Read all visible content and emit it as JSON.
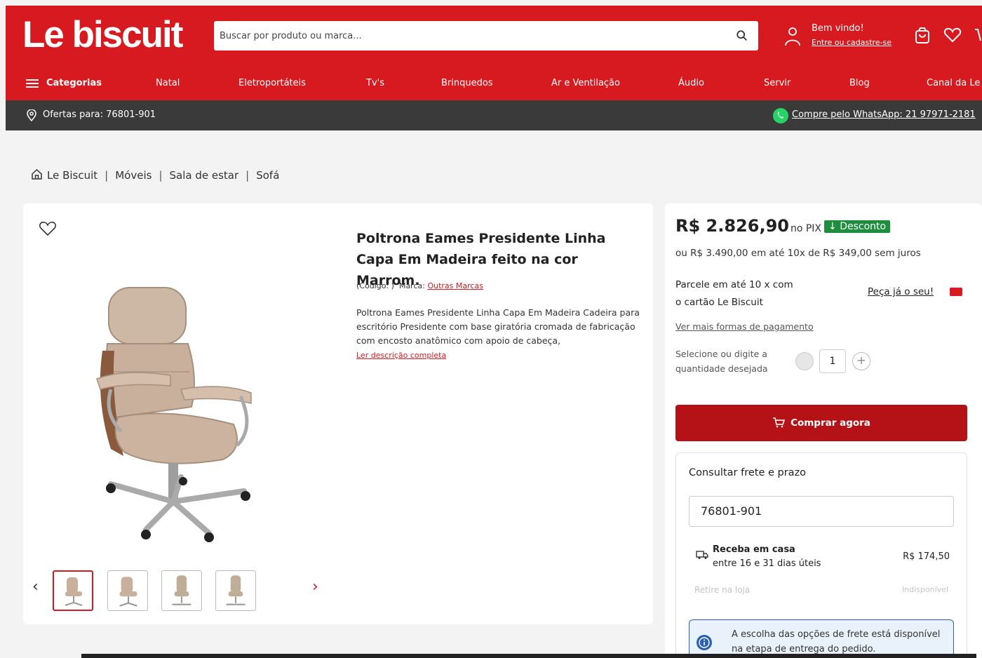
{
  "header": {
    "logo": "Le biscuit",
    "search_placeholder": "Buscar por produto ou marca...",
    "user_greeting": "Bem vindo!",
    "user_login": "Entre ou cadastre-se"
  },
  "nav": {
    "categories": "Categorias",
    "items": [
      "Natal",
      "Eletroportáteis",
      "Tv's",
      "Brinquedos",
      "Ar e Ventilação",
      "Áudio",
      "Servir",
      "Blog",
      "Canal da Le"
    ]
  },
  "offers": {
    "location": "Ofertas para: 76801-901",
    "whatsapp": "Compre pelo WhatsApp: 21 97971-2181"
  },
  "breadcrumb": [
    "Le Biscuit",
    "Móveis",
    "Sala de estar",
    "Sofá"
  ],
  "product": {
    "title": "Poltrona Eames Presidente Linha Capa Em Madeira feito na cor Marrom.",
    "code_label": "(Código: )",
    "brand_label": "Marca:",
    "brand": "Outras Marcas",
    "description": "Poltrona Eames Presidente Linha Capa Em Madeira Cadeira para escritório Presidente com base giratória cromada de fabricação com encosto anatômico com apoio de cabeça,",
    "read_more": "Ler descrição completa"
  },
  "buy": {
    "price": "R$ 2.826,90",
    "pix": "no PIX",
    "badge": "Desconto",
    "installments": "ou R$ 3.490,00 em até 10x de R$ 349,00 sem juros",
    "parcel_line1": "Parcele em até 10 x com",
    "parcel_line2": "o cartão Le Biscuit",
    "peca": "Peça já o seu!",
    "more_payment": "Ver mais formas de pagamento",
    "qty_label_1": "Selecione ou digite a",
    "qty_label_2": "quantidade desejada",
    "qty_value": "1",
    "buy_button": "Comprar agora"
  },
  "shipping": {
    "title": "Consultar frete e prazo",
    "cep": "76801-901",
    "option1_title": "Receba em casa",
    "option1_time": "entre 16 e 31 dias úteis",
    "option1_price": "R$ 174,50",
    "option2_title": "Retire na loja",
    "option2_status": "Indisponível",
    "info": "A escolha das opções de frete está disponível na etapa de entrega do pedido."
  },
  "colors": {
    "brand": "#d71920",
    "dark_bar": "#3a3a3a",
    "badge": "#1e8e3e"
  }
}
